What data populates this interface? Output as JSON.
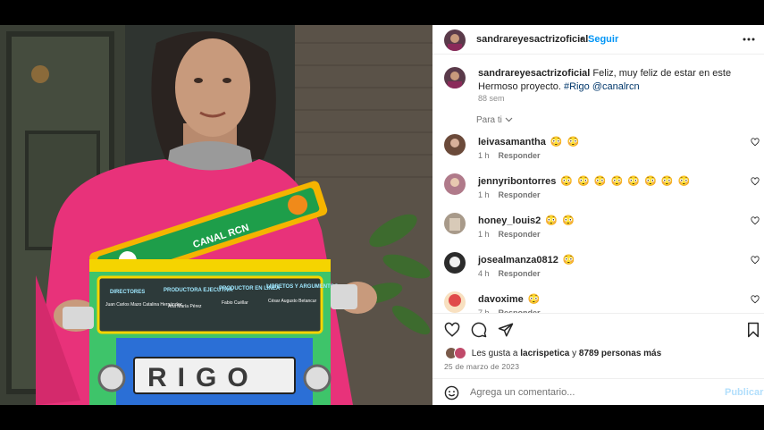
{
  "post": {
    "username": "sandrareyesactrizoficial",
    "dot": "•",
    "follow_label": "Seguir",
    "more_icon": "more-horizontal-icon"
  },
  "caption": {
    "username": "sandrareyesactrizoficial",
    "text": "Feliz, muy feliz de estar en este Hermoso proyecto.",
    "hashtag": "#Rigo",
    "mention": "@canalrcn",
    "time": "88 sem"
  },
  "sort_label": "Para ti",
  "reply_label": "Responder",
  "comments": [
    {
      "user": "leivasamantha",
      "text": "😳 😳",
      "time": "1 h",
      "avatar_color": "#6b4a3a"
    },
    {
      "user": "jennyribontorres",
      "text": "😳 😳 😳 😳 😳 😳 😳 😳",
      "time": "1 h",
      "avatar_color": "#b07a8a"
    },
    {
      "user": "honey_louis2",
      "text": "😳 😳",
      "time": "1 h",
      "avatar_color": "#a89a8a"
    },
    {
      "user": "josealmanza0812",
      "text": "😳",
      "time": "4 h",
      "avatar_color": "#2b2b2b"
    },
    {
      "user": "davoxime",
      "text": "😳",
      "time": "7 h",
      "avatar_color": "#e04a4a"
    }
  ],
  "likes": {
    "prefix": "Les gusta a",
    "user": "lacrispetica",
    "middle": "y",
    "count_text": "8789 personas más"
  },
  "date": "25 de marzo de 2023",
  "add_comment": {
    "placeholder": "Agrega un comentario...",
    "publish_label": "Publicar"
  },
  "photo": {
    "sign_brand": "CANAL RCN",
    "plate_text": "RIGO",
    "credits": [
      {
        "role": "DIRECTORES",
        "names": "Juan Carlos Mazo Catalina Hernández"
      },
      {
        "role": "PRODUCTORA EJECUTIVA",
        "names": "Ana María Pérez"
      },
      {
        "role": "PRODUCTOR EN LÍNEA",
        "names": "Fabio Cuéllar"
      },
      {
        "role": "LIBRETOS Y ARGUMENTOS",
        "names": "César Augusto Betancur"
      }
    ]
  },
  "colors": {
    "follow": "#0095f6",
    "publish_disabled": "#b2dffc",
    "sweater": "#e8327a",
    "sign_green": "#1e9e4a"
  }
}
